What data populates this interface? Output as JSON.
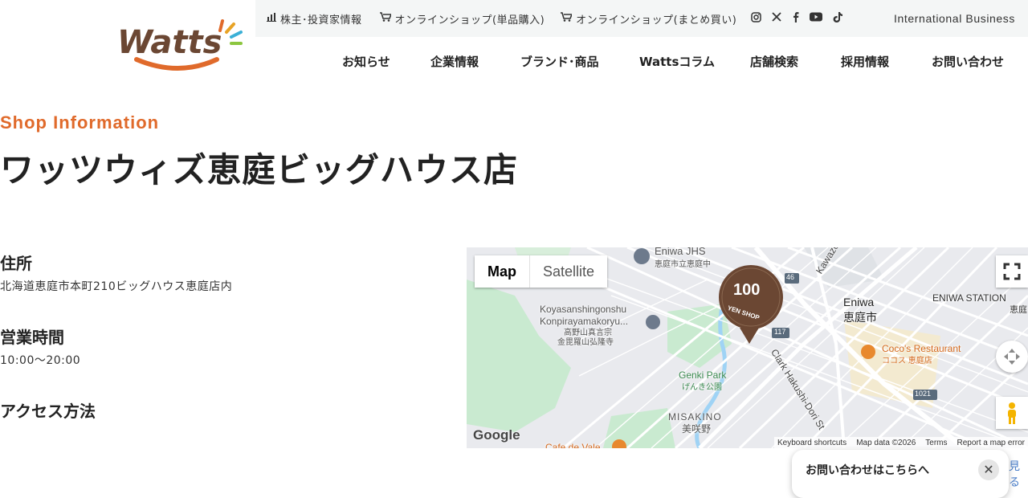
{
  "header": {
    "logo_text": "Watts",
    "top_links": [
      {
        "icon": "chart-icon",
        "label": "株主･投資家情報"
      },
      {
        "icon": "cart-icon",
        "label": "オンラインショップ(単品購入)"
      },
      {
        "icon": "cart-icon",
        "label": "オンラインショップ(まとめ買い)"
      }
    ],
    "social": [
      "instagram-icon",
      "x-icon",
      "facebook-icon",
      "youtube-icon",
      "tiktok-icon"
    ],
    "international": "International Business",
    "nav": [
      "お知らせ",
      "企業情報",
      "ブランド･商品",
      "Wattsコラム",
      "店舗検索",
      "採用情報",
      "お問い合わせ"
    ]
  },
  "page": {
    "eyebrow": "Shop Information",
    "title": "ワッツウィズ恵庭ビッグハウス店",
    "address_label": "住所",
    "address": "北海道恵庭市本町210ビッグハウス恵庭店内",
    "hours_label": "営業時間",
    "hours": "10:00〜20:00",
    "access_label": "アクセス方法"
  },
  "map": {
    "type_map": "Map",
    "type_satellite": "Satellite",
    "google": "Google",
    "labels": {
      "jhs_en": "Eniwa JHS",
      "jhs_ja": "恵庭市立恵庭中",
      "temple_en1": "Koyasanshingonshu",
      "temple_en2": "Konpirayamakoryu...",
      "temple_ja1": "高野山真言宗",
      "temple_ja2": "金毘羅山弘隆寺",
      "eniwa_en": "Eniwa",
      "eniwa_ja": "恵庭市",
      "station": "ENIWA STATION",
      "station_ja": "恵庭",
      "kawazoe": "Kawazoe odori",
      "coco_en": "Coco's Restaurant",
      "coco_ja": "ココス 恵庭店",
      "genki_en": "Genki Park",
      "genki_ja": "げんき公園",
      "misakino_en": "MISAKINO",
      "misakino_ja": "美咲野",
      "clark": "Clark Hakushi-Dori St",
      "cafe": "Cafe de Vale",
      "road46": "46",
      "road117": "117",
      "road1021": "1021",
      "marker_num": "100",
      "marker_text": "YEN SHOP"
    },
    "attribution": [
      "Keyboard shortcuts",
      "Map data ©2026",
      "Terms",
      "Report a map error"
    ]
  },
  "popup": {
    "text": "お問い合わせはこちらへ",
    "close": "✕"
  },
  "edge_text": "見る",
  "colors": {
    "accent": "#e06a2b",
    "logo_brown": "#6b4733",
    "marker_brown": "#6b4733",
    "park_green": "#c9ead0",
    "water": "#9fd3f5"
  }
}
